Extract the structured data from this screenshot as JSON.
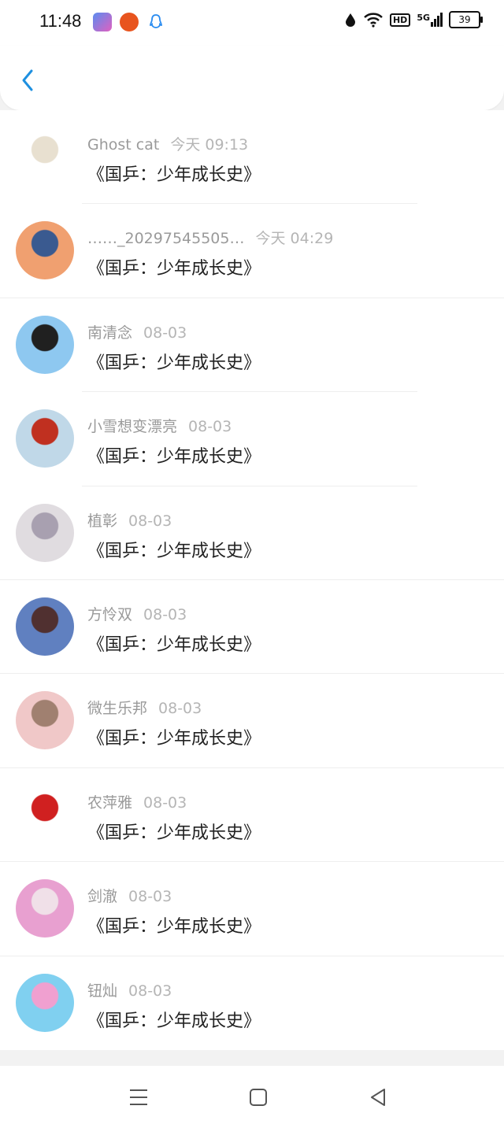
{
  "status_bar": {
    "time": "11:48",
    "battery": "39",
    "network": "5G",
    "hd": "HD"
  },
  "list": [
    {
      "name": "Ghost cat",
      "time": "今天 09:13",
      "title": "《国乒：少年成长史》",
      "avatar_colors": [
        "#ffffff",
        "#e8e0d0"
      ]
    },
    {
      "name": "……_20297545505…",
      "time": "今天 04:29",
      "title": "《国乒：少年成长史》",
      "avatar_colors": [
        "#f0a070",
        "#3a5a90"
      ]
    },
    {
      "name": "南清念",
      "time": "08-03",
      "title": "《国乒：少年成长史》",
      "avatar_colors": [
        "#8ec8f0",
        "#202020"
      ]
    },
    {
      "name": "小雪想变漂亮",
      "time": "08-03",
      "title": "《国乒：少年成长史》",
      "avatar_colors": [
        "#c0d8e8",
        "#c03020"
      ]
    },
    {
      "name": "植彰",
      "time": "08-03",
      "title": "《国乒：少年成长史》",
      "avatar_colors": [
        "#e0dce0",
        "#a8a0b0"
      ]
    },
    {
      "name": "方怜双",
      "time": "08-03",
      "title": "《国乒：少年成长史》",
      "avatar_colors": [
        "#6080c0",
        "#503030"
      ]
    },
    {
      "name": "微生乐邦",
      "time": "08-03",
      "title": "《国乒：少年成长史》",
      "avatar_colors": [
        "#f0c8c8",
        "#a08070"
      ]
    },
    {
      "name": "农萍雅",
      "time": "08-03",
      "title": "《国乒：少年成长史》",
      "avatar_colors": [
        "#ffffff",
        "#d02020"
      ]
    },
    {
      "name": "剑澈",
      "time": "08-03",
      "title": "《国乒：少年成长史》",
      "avatar_colors": [
        "#e8a0d0",
        "#f0e0e8"
      ]
    },
    {
      "name": "钮灿",
      "time": "08-03",
      "title": "《国乒：少年成长史》",
      "avatar_colors": [
        "#80d0f0",
        "#f0a0d0"
      ]
    }
  ],
  "accent": "#1e90e0"
}
